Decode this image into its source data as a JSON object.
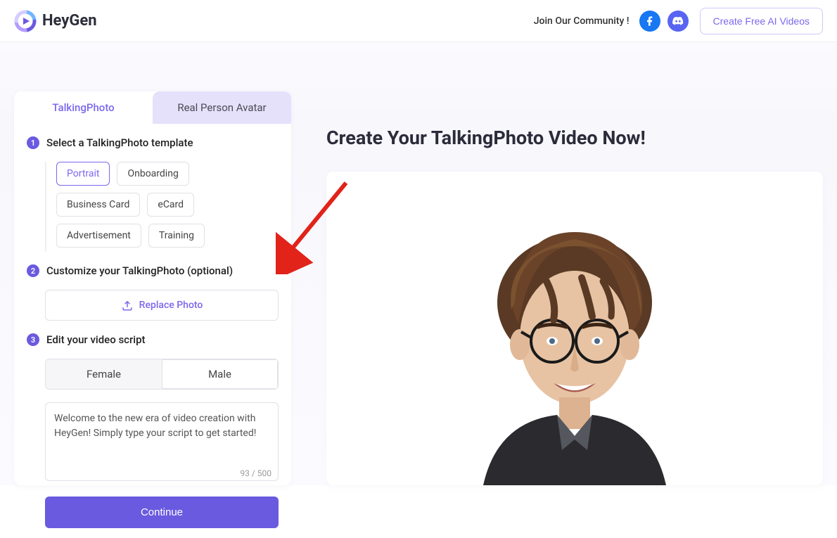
{
  "header": {
    "brand": "HeyGen",
    "join_text": "Join Our Community !",
    "cta": "Create Free AI Videos"
  },
  "tabs": {
    "talking_photo": "TalkingPhoto",
    "real_person": "Real Person Avatar"
  },
  "step1": {
    "num": "1",
    "title": "Select a TalkingPhoto template",
    "templates": {
      "portrait": "Portrait",
      "onboarding": "Onboarding",
      "business_card": "Business Card",
      "ecard": "eCard",
      "advertisement": "Advertisement",
      "training": "Training"
    }
  },
  "step2": {
    "num": "2",
    "title": "Customize your TalkingPhoto (optional)",
    "replace_label": "Replace Photo"
  },
  "step3": {
    "num": "3",
    "title": "Edit your video script",
    "female": "Female",
    "male": "Male",
    "script_text": "Welcome to the new era of video creation with HeyGen! Simply type your script to get started!",
    "counter": "93 / 500"
  },
  "continue_label": "Continue",
  "headline": "Create Your TalkingPhoto Video Now!"
}
